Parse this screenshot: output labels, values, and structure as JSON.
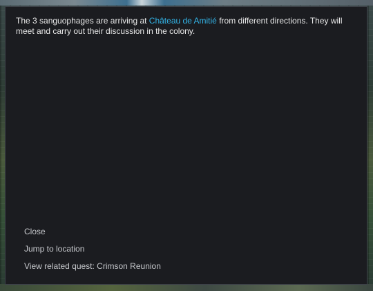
{
  "dialog": {
    "message": {
      "before": "The 3 sanguophages are arriving at ",
      "place": "Château de Amitié",
      "after": " from different directions. They will meet and carry out their discussion in the colony."
    },
    "options": [
      {
        "label": "Close"
      },
      {
        "label": "Jump to location"
      },
      {
        "label": "View related quest: Crimson Reunion"
      }
    ]
  },
  "colors": {
    "dialog_background": "#1b1c20",
    "place_highlight": "#33b5e8",
    "text": "#e8e8e8",
    "option_text": "#c6c8cc"
  }
}
